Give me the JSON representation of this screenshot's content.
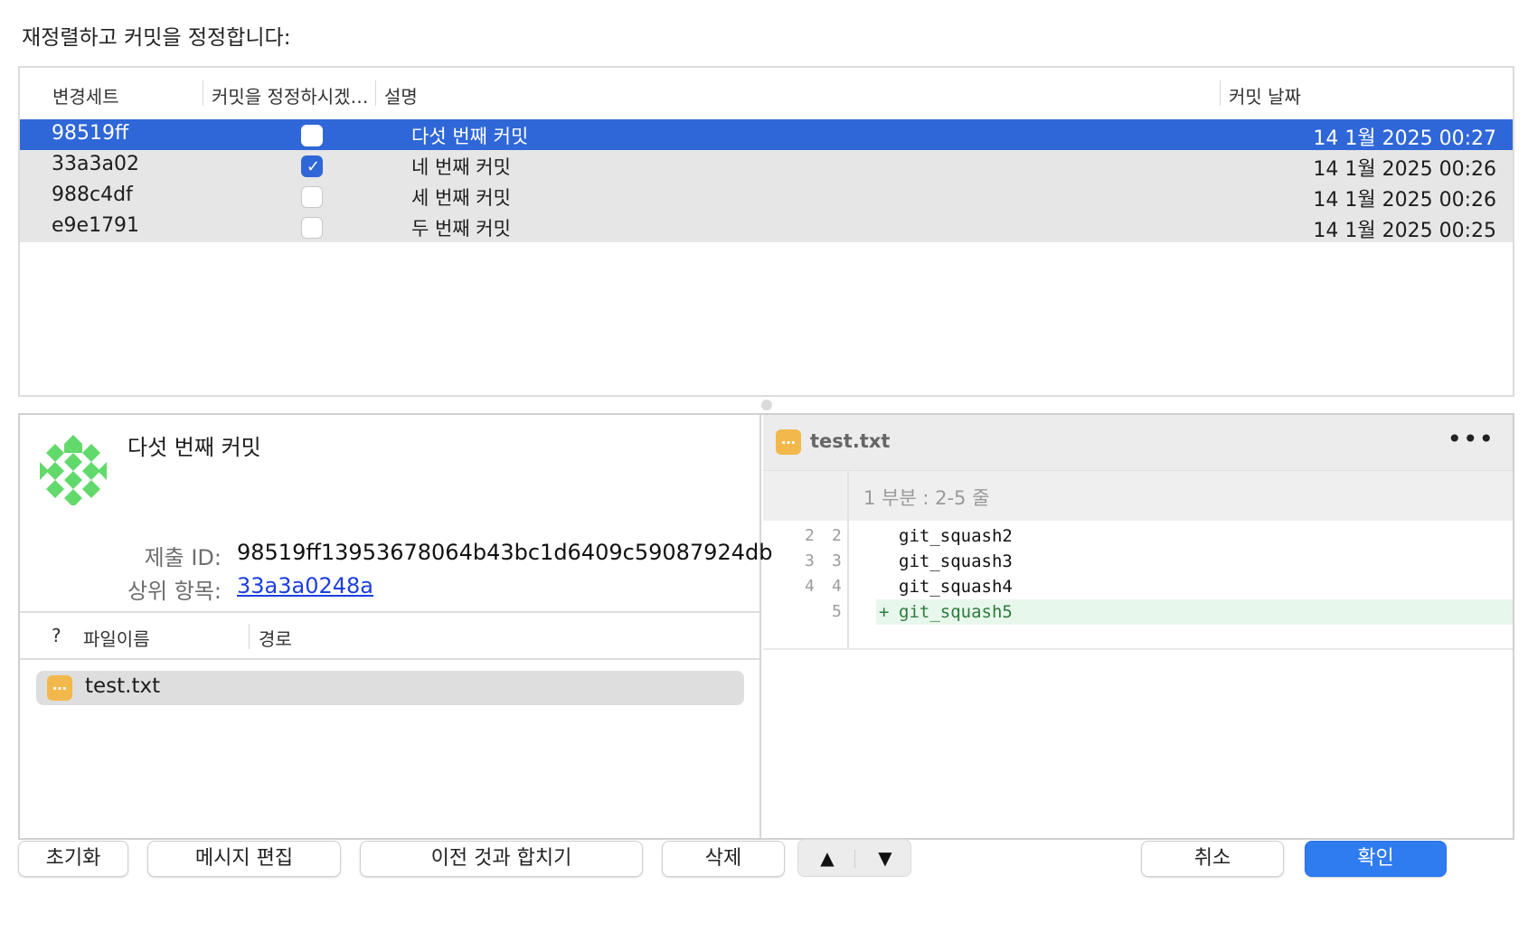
{
  "heading": "재정렬하고 커밋을 정정합니다:",
  "table": {
    "columns": {
      "changeset": "변경세트",
      "amend": "커밋을 정정하시겠…",
      "description": "설명",
      "date": "커밋 날짜"
    },
    "rows": [
      {
        "hash": "98519ff",
        "amend": false,
        "description": "다섯 번째 커밋",
        "date": "14 1월 2025 00:27",
        "selected": true
      },
      {
        "hash": "33a3a02",
        "amend": true,
        "description": "네 번째 커밋",
        "date": "14 1월 2025 00:26",
        "selected": false
      },
      {
        "hash": "988c4df",
        "amend": false,
        "description": "세 번째 커밋",
        "date": "14 1월 2025 00:26",
        "selected": false
      },
      {
        "hash": "e9e1791",
        "amend": false,
        "description": "두 번째 커밋",
        "date": "14 1월 2025 00:25",
        "selected": false
      }
    ]
  },
  "detail": {
    "title": "다섯 번째 커밋",
    "commit_id_label": "제출 ID:",
    "commit_id": "98519ff13953678064b43bc1d6409c59087924db",
    "parent_label": "상위 항목:",
    "parent": "33a3a0248a",
    "file_columns": {
      "status": "?",
      "filename": "파일이름",
      "path": "경로"
    },
    "files": [
      {
        "name": "test.txt"
      }
    ]
  },
  "diff": {
    "filename": "test.txt",
    "more": "•••",
    "hunk_header": "1 부분 : 2-5 줄",
    "lines": [
      {
        "old": "2",
        "new": "2",
        "code": "git_squash2",
        "added": false
      },
      {
        "old": "3",
        "new": "3",
        "code": "git_squash3",
        "added": false
      },
      {
        "old": "4",
        "new": "4",
        "code": "git_squash4",
        "added": false
      },
      {
        "old": "",
        "new": "5",
        "code": "git_squash5",
        "added": true
      }
    ]
  },
  "buttons": {
    "reset": "초기화",
    "edit_message": "메시지 편집",
    "squash": "이전 것과 합치기",
    "delete": "삭제",
    "up": "▲",
    "down": "▼",
    "cancel": "취소",
    "ok": "확인"
  },
  "colors": {
    "selection": "#2f67d8",
    "primary": "#2f7bf0",
    "file_icon": "#f2b84b",
    "added_bg": "#e8f7ec"
  }
}
